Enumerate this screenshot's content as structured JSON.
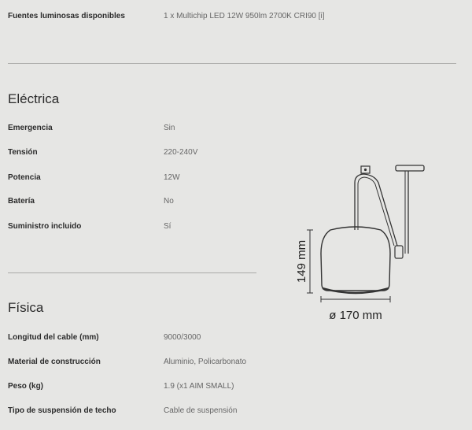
{
  "top": {
    "label": "Fuentes luminosas disponibles",
    "value": "1 x Multichip LED 12W 950lm 2700K CRI90 [i]"
  },
  "electrica": {
    "title": "Eléctrica",
    "rows": [
      {
        "label": "Emergencia",
        "value": "Sin"
      },
      {
        "label": "Tensión",
        "value": "220-240V"
      },
      {
        "label": "Potencia",
        "value": "12W"
      },
      {
        "label": "Batería",
        "value": "No"
      },
      {
        "label": "Suministro incluido",
        "value": "Sí"
      }
    ]
  },
  "fisica": {
    "title": "Física",
    "rows": [
      {
        "label": "Longitud del cable (mm)",
        "value": "9000/3000"
      },
      {
        "label": "Material de construcción",
        "value": "Aluminio, Policarbonato"
      },
      {
        "label": "Peso (kg)",
        "value": "1.9 (x1 AIM SMALL)"
      },
      {
        "label": "Tipo de suspensión de techo",
        "value": "Cable de suspensión"
      }
    ]
  },
  "diagram": {
    "height_label": "149 mm",
    "diameter_label": "ø 170 mm"
  }
}
